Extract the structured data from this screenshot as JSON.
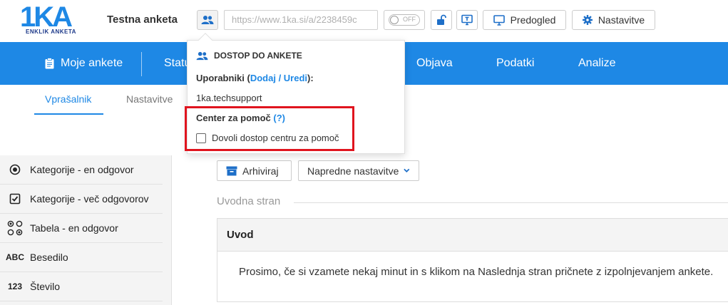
{
  "header": {
    "logo_main": "1KA",
    "logo_sub": "ENKLIK ANKETA",
    "survey_title": "Testna anketa",
    "url": "https://www.1ka.si/a/2238459c",
    "toggle_label": "OFF",
    "preview_label": "Predogled",
    "settings_label": "Nastavitve"
  },
  "nav": {
    "items": [
      {
        "label": "Moje ankete"
      },
      {
        "label": "Statu"
      },
      {
        "label": "Objava"
      },
      {
        "label": "Podatki"
      },
      {
        "label": "Analize"
      }
    ]
  },
  "subtabs": [
    {
      "label": "Vprašalnik",
      "active": true
    },
    {
      "label": "Nastavitve",
      "active": false
    }
  ],
  "sidebar": {
    "items": [
      {
        "icon": "radio-icon",
        "label": "Kategorije - en odgovor"
      },
      {
        "icon": "checkbox-icon",
        "label": "Kategorije - več odgovorov"
      },
      {
        "icon": "grid-icon",
        "label": "Tabela - en odgovor"
      },
      {
        "icon": "ABC",
        "label": "Besedilo"
      },
      {
        "icon": "123",
        "label": "Število"
      }
    ]
  },
  "toolbar": {
    "archive_label": "Arhiviraj",
    "advanced_label": "Napredne nastavitve"
  },
  "main": {
    "section_label": "Uvodna stran",
    "intro_title": "Uvod",
    "intro_text": "Prosimo, če si vzamete nekaj minut in s klikom na Naslednja stran pričnete z izpolnjevanjem ankete."
  },
  "popup": {
    "title": "DOSTOP DO ANKETE",
    "users_label": "Uporabniki (",
    "users_link": "Dodaj / Uredi",
    "users_suffix": "):",
    "user": "1ka.techsupport",
    "help_label": "Center za pomoč",
    "help_link": "(?)",
    "checkbox_label": "Dovoli dostop centru za pomoč",
    "checkbox_checked": false
  },
  "colors": {
    "accent": "#1e88e5",
    "highlight": "#e0141e"
  }
}
